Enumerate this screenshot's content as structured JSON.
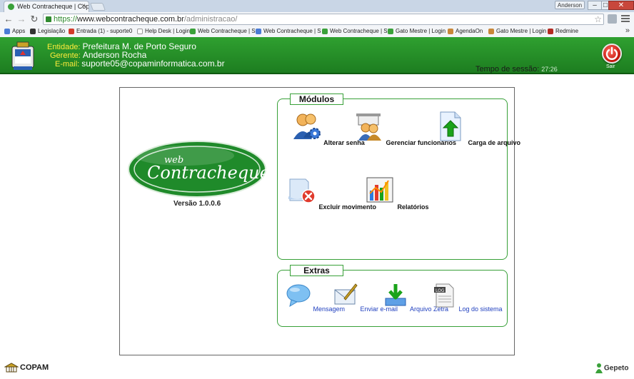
{
  "browser": {
    "tab_title": "Web Contracheque | Cop",
    "user": "Anderson",
    "url_scheme": "https://",
    "url_host": "www.webcontracheque.com.br",
    "url_path": "/administracao/",
    "bookmarks": [
      {
        "label": "Apps",
        "color": "#4a7bd4"
      },
      {
        "label": "Legislação",
        "color": "#333333"
      },
      {
        "label": "Entrada (1) - suporte0",
        "color": "#d23b2b"
      },
      {
        "label": "Help Desk | Login",
        "color": "#ffffff"
      },
      {
        "label": "Web Contracheque | S",
        "color": "#3aa13a"
      },
      {
        "label": "Web Contracheque | S",
        "color": "#4a7bd4"
      },
      {
        "label": "Web Contracheque | S",
        "color": "#3aa13a"
      },
      {
        "label": "Gato Mestre | Login",
        "color": "#3aa13a"
      },
      {
        "label": "AgendaOn",
        "color": "#c8873a"
      },
      {
        "label": "Gato Mestre | Login",
        "color": "#c8873a"
      },
      {
        "label": "Redmine",
        "color": "#b32b22"
      }
    ]
  },
  "header": {
    "entidade_label": "Entidade:",
    "entidade_value": "Prefeitura M. de Porto Seguro",
    "gerente_label": "Gerente:",
    "gerente_value": "Anderson Rocha",
    "email_label": "E-mail:",
    "email_value": "suporte05@copaminformatica.com.br",
    "session_label": "Tempo de sessão:",
    "session_time": "27:26",
    "logout_label": "Sair"
  },
  "main": {
    "logo_small": "web",
    "logo_text": "Contracheque",
    "version": "Versão 1.0.0.6",
    "modules_title": "Módulos",
    "modules": [
      {
        "label": "Alterar senha",
        "icon": "users-gear-icon"
      },
      {
        "label": "Gerenciar funcionários",
        "icon": "manage-employees-icon"
      },
      {
        "label": "Carga de arquivo",
        "icon": "upload-file-icon"
      },
      {
        "label": "Excluir movimento",
        "icon": "delete-movement-icon"
      },
      {
        "label": "Relatórios",
        "icon": "reports-chart-icon"
      }
    ],
    "extras_title": "Extras",
    "extras": [
      {
        "label": "Mensagem",
        "icon": "message-bubble-icon"
      },
      {
        "label": "Enviar e-mail",
        "icon": "send-email-icon"
      },
      {
        "label": "Arquivo Zetra",
        "icon": "download-archive-icon"
      },
      {
        "label": "Log do sistema",
        "icon": "log-file-icon"
      }
    ]
  },
  "footer": {
    "left_brand": "COPAM",
    "right_brand": "Gepeto"
  },
  "colors": {
    "header_green": "#2fa030",
    "panel_border": "#38a038",
    "link_blue": "#1f3fbf"
  }
}
